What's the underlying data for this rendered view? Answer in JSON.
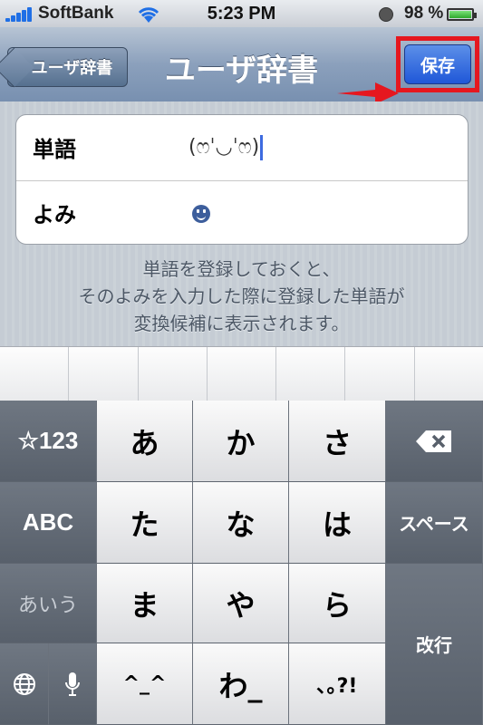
{
  "status": {
    "carrier": "SoftBank",
    "time": "5:23 PM",
    "battery": "98 %",
    "battery_level": 0.98,
    "icons": [
      "signal-icon",
      "wifi-icon",
      "clock-icon",
      "battery-icon"
    ]
  },
  "nav": {
    "back_label": "ユーザ辞書",
    "title": "ユーザ辞書",
    "save_label": "保存"
  },
  "form": {
    "word_label": "単語",
    "word_value": "(ෆˈ◡ˈෆ)",
    "reading_label": "よみ",
    "reading_value": "smiley-icon"
  },
  "description": {
    "line1": "単語を登録しておくと、",
    "line2": "そのよみを入力した際に登録した単語が",
    "line3": "変換候補に表示されます。"
  },
  "keyboard": {
    "mode_number": "☆123",
    "mode_abc": "ABC",
    "mode_kana": "あいう",
    "keys_row1": [
      "あ",
      "か",
      "さ"
    ],
    "keys_row2": [
      "た",
      "な",
      "は"
    ],
    "keys_row3": [
      "ま",
      "や",
      "ら"
    ],
    "keys_row4": [
      "^_^",
      "わ_",
      "､｡?!"
    ],
    "space_label": "スペース",
    "return_label": "改行",
    "icons": [
      "globe-icon",
      "microphone-icon",
      "backspace-icon"
    ]
  },
  "colors": {
    "accent_blue": "#1f57d8",
    "highlight_red": "#e5171f",
    "nav_bar": "#8ba0bc"
  }
}
